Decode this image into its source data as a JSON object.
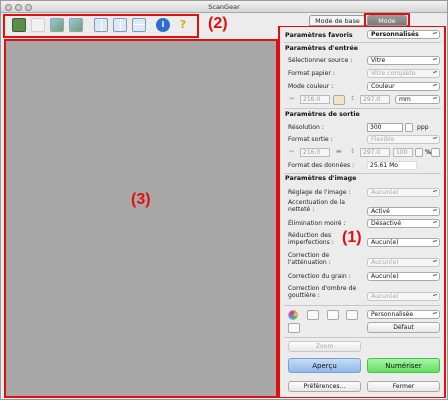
{
  "window": {
    "title": "ScanGear"
  },
  "callouts": {
    "one": "(1)",
    "two": "(2)",
    "three": "(3)"
  },
  "tabs": {
    "basic": "Mode de base",
    "advanced": "Mode avancé"
  },
  "favorites": {
    "label": "Paramètres favoris",
    "value": "Personnalisés"
  },
  "input": {
    "heading": "Paramètres d'entrée",
    "source_label": "Sélectionner source :",
    "source_value": "Vitre",
    "paper_label": "Format papier :",
    "paper_value": "Vitre complète",
    "color_label": "Mode couleur :",
    "color_value": "Couleur",
    "width": "216.0",
    "height": "297.0",
    "unit": "mm"
  },
  "output": {
    "heading": "Paramètres de sortie",
    "resolution_label": "Résolution :",
    "resolution_value": "300",
    "resolution_unit": "ppp",
    "format_label": "Format sortie :",
    "format_value": "Flexible",
    "width": "216.0",
    "height": "297.0",
    "scale": "100",
    "scale_unit": "%",
    "datasize_label": "Format des données :",
    "datasize_value": "25.61 Mo"
  },
  "image": {
    "heading": "Paramètres d'image",
    "rows": [
      {
        "label": "Réglage de l'image :",
        "value": "Aucun(e)",
        "enabled": false
      },
      {
        "label": "Accentuation de la netteté :",
        "value": "Activé",
        "enabled": true
      },
      {
        "label": "Élimination moiré :",
        "value": "Désactivé",
        "enabled": true
      },
      {
        "label": "Réduction des imperfections :",
        "value": "Aucun(e)",
        "enabled": true
      },
      {
        "label": "Correction de l'atténuation :",
        "value": "Aucun(e)",
        "enabled": false
      },
      {
        "label": "Correction du grain :",
        "value": "Aucun(e)",
        "enabled": true
      },
      {
        "label": "Correction d'ombre de gouttière :",
        "value": "Aucun(e)",
        "enabled": false
      }
    ]
  },
  "adjust": {
    "preset_value": "Personnalisée",
    "default_label": "Défaut"
  },
  "buttons": {
    "zoom": "Zoom",
    "preview": "Aperçu",
    "scan": "Numériser",
    "preferences": "Préférences...",
    "close": "Fermer"
  },
  "colors": {
    "accent": "#e01010",
    "scan_button": "#7cf07c",
    "preview_button": "#a9cbf5"
  }
}
